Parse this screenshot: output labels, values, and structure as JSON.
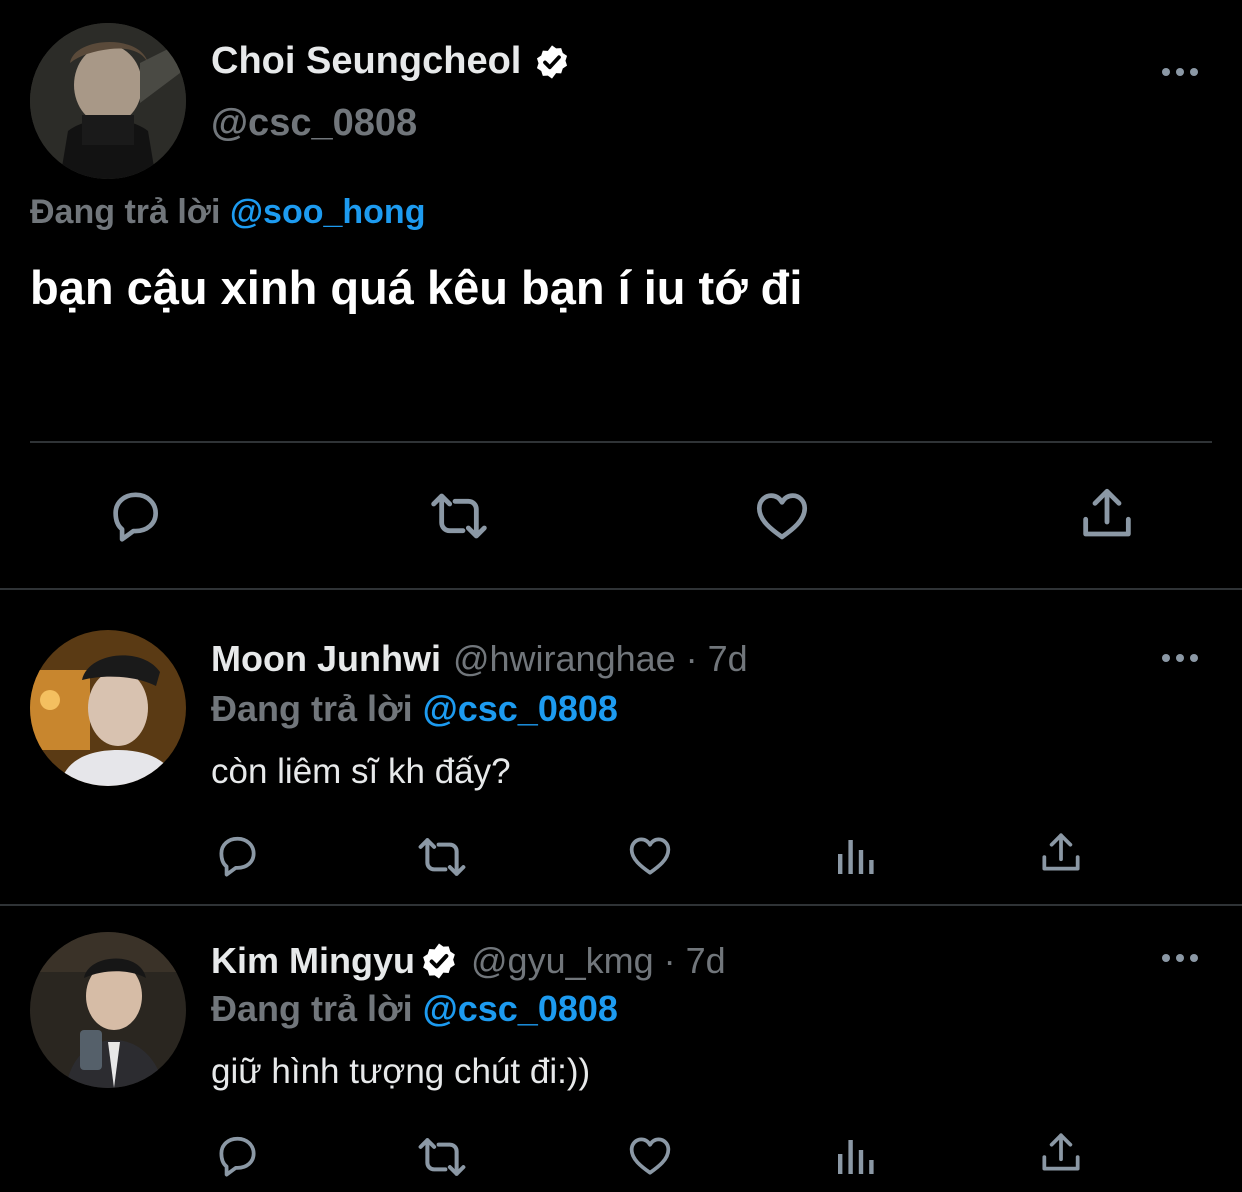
{
  "main_tweet": {
    "author_name": "Choi Seungcheol",
    "author_handle": "@csc_0808",
    "verified": true,
    "reply_prefix": "Đang trả lời",
    "reply_to": "@soo_hong",
    "text": "bạn cậu xinh quá kêu bạn í iu tớ đi",
    "actions": [
      "reply-icon",
      "retweet-icon",
      "like-icon",
      "share-icon"
    ]
  },
  "replies": [
    {
      "author_name": "Moon Junhwi",
      "author_handle": "@hwiranghae",
      "separator": "·",
      "time": "7d",
      "verified": false,
      "reply_prefix": "Đang trả lời",
      "reply_to": "@csc_0808",
      "text": "còn liêm sĩ kh đấy?",
      "actions": [
        "reply-icon",
        "retweet-icon",
        "like-icon",
        "analytics-icon",
        "share-icon"
      ]
    },
    {
      "author_name": "Kim Mingyu",
      "author_handle": "@gyu_kmg",
      "separator": "·",
      "time": "7d",
      "verified": true,
      "reply_prefix": "Đang trả lời",
      "reply_to": "@csc_0808",
      "text": "giữ hình tượng chút đi:))",
      "actions": [
        "reply-icon",
        "retweet-icon",
        "like-icon",
        "analytics-icon",
        "share-icon"
      ]
    }
  ],
  "colors": {
    "background": "#000000",
    "text": "#e7e9ea",
    "muted": "#71767b",
    "accent": "#1d9bf0",
    "divider": "#2f3336",
    "icon": "#8b98a5"
  }
}
